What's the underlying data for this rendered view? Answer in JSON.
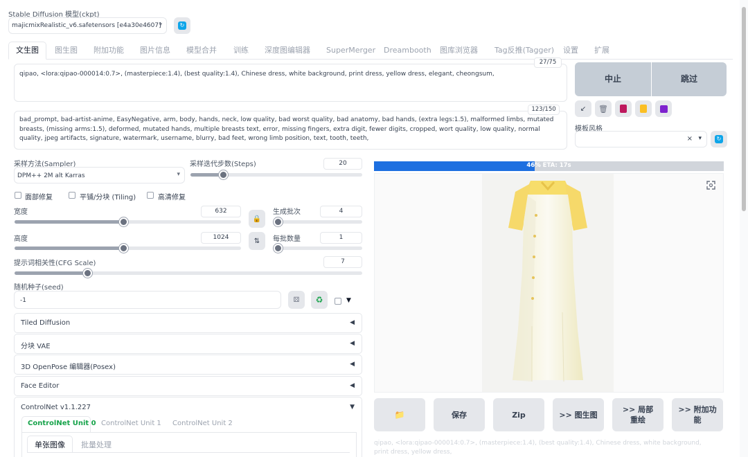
{
  "model": {
    "label": "Stable Diffusion 模型(ckpt)",
    "selected": "majicmixRealistic_v6.safetensors [e4a30e4607]"
  },
  "tabs": [
    "文生图",
    "图生图",
    "附加功能",
    "图片信息",
    "模型合并",
    "训练",
    "深度图编辑器",
    "SuperMerger",
    "Dreambooth",
    "图库浏览器",
    "Tag反推(Tagger)",
    "设置",
    "扩展"
  ],
  "prompt": {
    "text": "qipao, <lora:qipao-000014:0.7>, (masterpiece:1.4), (best quality:1.4), Chinese dress, white background, print dress, yellow dress, elegant, cheongsum,",
    "count": "27/75"
  },
  "negative": {
    "text": "bad_prompt, bad-artist-anime, EasyNegative, arm, body, hands, neck, low quality, bad worst quality, bad anatomy, bad hands, (extra legs:1.5), malformed limbs, mutated breasts, (missing arms:1.5), deformed, mutated hands, multiple breasts text, error, missing fingers, extra digit, fewer digits, cropped, wort quality, low quality, normal quality, jpeg artifacts, signature, watermark, username, blurry, bad feet, wrong limb position, text, tooth, teeth,",
    "count": "123/150"
  },
  "actions": {
    "interrupt": "中止",
    "skip": "跳过"
  },
  "styles": {
    "label": "模板风格",
    "clear": "×",
    "caret": "▾"
  },
  "sampler": {
    "label": "采样方法(Sampler)",
    "value": "DPM++ 2M alt Karras"
  },
  "steps": {
    "label": "采样迭代步数(Steps)",
    "value": "20",
    "fraction": 0.19
  },
  "checks": {
    "face": "面部修复",
    "tiling": "平铺/分块 (Tiling)",
    "hires": "高清修复"
  },
  "width": {
    "label": "宽度",
    "value": "632",
    "fraction": 0.48
  },
  "height": {
    "label": "高度",
    "value": "1024",
    "fraction": 0.48
  },
  "batch_count": {
    "label": "生成批次",
    "value": "4",
    "fraction": 0.03
  },
  "batch_size": {
    "label": "每批数量",
    "value": "1",
    "fraction": 0.0
  },
  "cfg": {
    "label": "提示词相关性(CFG Scale)",
    "value": "7",
    "fraction": 0.21
  },
  "seed": {
    "label": "随机种子(seed)",
    "value": "-1",
    "extra_arrow": "▼"
  },
  "accordions": [
    {
      "title": "Tiled Diffusion",
      "arrow": "◀"
    },
    {
      "title": "分块 VAE",
      "arrow": "◀"
    },
    {
      "title": "3D OpenPose 编辑器(Posex)",
      "arrow": "◀"
    },
    {
      "title": "Face Editor",
      "arrow": "◀"
    },
    {
      "title": "ControlNet v1.1.227",
      "arrow": "▼"
    }
  ],
  "controlnet": {
    "units": [
      "ControlNet Unit 0",
      "ControlNet Unit 1",
      "ControlNet Unit 2"
    ],
    "subtabs": [
      "单张图像",
      "批量处理"
    ]
  },
  "progress": {
    "text": "46% ETA: 17s",
    "fraction": 0.46
  },
  "gallery_buttons": [
    "保存",
    "Zip",
    ">> 图生图",
    ">> 局部重绘",
    ">> 附加功能"
  ],
  "caption": "qipao, <lora:qipao-000014:0.7>, (masterpiece:1.4), (best quality:1.4), Chinese dress, white background, print dress, yellow dress,",
  "colors": {
    "progress": "#1d6fe0",
    "active_tab": "#111827",
    "accent_green": "#16a34a",
    "button_bg": "#e5e7eb"
  }
}
